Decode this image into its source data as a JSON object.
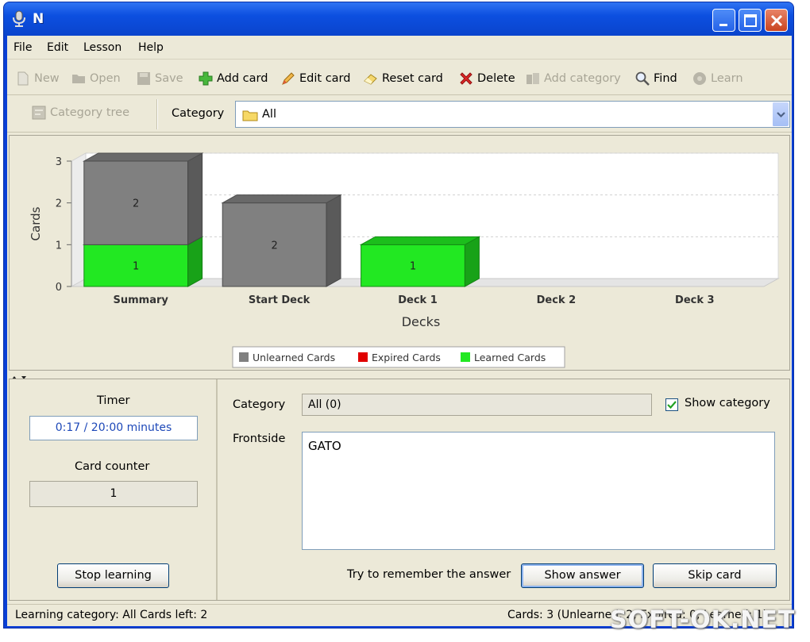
{
  "window": {
    "title": "N"
  },
  "menu": [
    "File",
    "Edit",
    "Lesson",
    "Help"
  ],
  "toolbar": {
    "new": "New",
    "open": "Open",
    "save": "Save",
    "add_card": "Add card",
    "edit_card": "Edit card",
    "reset_card": "Reset card",
    "delete": "Delete",
    "add_category": "Add category",
    "find": "Find",
    "learn": "Learn"
  },
  "category_bar": {
    "tree_button": "Category tree",
    "label": "Category",
    "selected": "All"
  },
  "chart_data": {
    "type": "bar",
    "stacked": true,
    "categories": [
      "Summary",
      "Start Deck",
      "Deck 1",
      "Deck 2",
      "Deck 3"
    ],
    "series": [
      {
        "name": "Unlearned Cards",
        "color": "#808080",
        "values": [
          2,
          2,
          0,
          0,
          0
        ]
      },
      {
        "name": "Expired Cards",
        "color": "#e00000",
        "values": [
          0,
          0,
          0,
          0,
          0
        ]
      },
      {
        "name": "Learned Cards",
        "color": "#22e822",
        "values": [
          1,
          0,
          1,
          0,
          0
        ]
      }
    ],
    "xlabel": "Decks",
    "ylabel": "Cards",
    "ylim": [
      0,
      3
    ],
    "yticks": [
      "0",
      "1",
      "2",
      "3"
    ],
    "legend_position": "bottom",
    "grid": true
  },
  "learning": {
    "timer_label": "Timer",
    "timer_value": "0:17 / 20:00 minutes",
    "counter_label": "Card counter",
    "counter_value": "1",
    "stop_button": "Stop learning"
  },
  "card": {
    "category_label": "Category",
    "category_value": "All (0)",
    "show_category_label": "Show category",
    "show_category_checked": true,
    "frontside_label": "Frontside",
    "frontside_text": "GATO",
    "hint": "Try to remember the answer",
    "show_answer_button": "Show answer",
    "skip_button": "Skip card"
  },
  "status": {
    "left": "Learning category: All  Cards left: 2",
    "right": "Cards: 3 (Unlearned: 2, Expired: 0, Learned: 1)"
  },
  "watermark": "SOFT-OK.NET"
}
